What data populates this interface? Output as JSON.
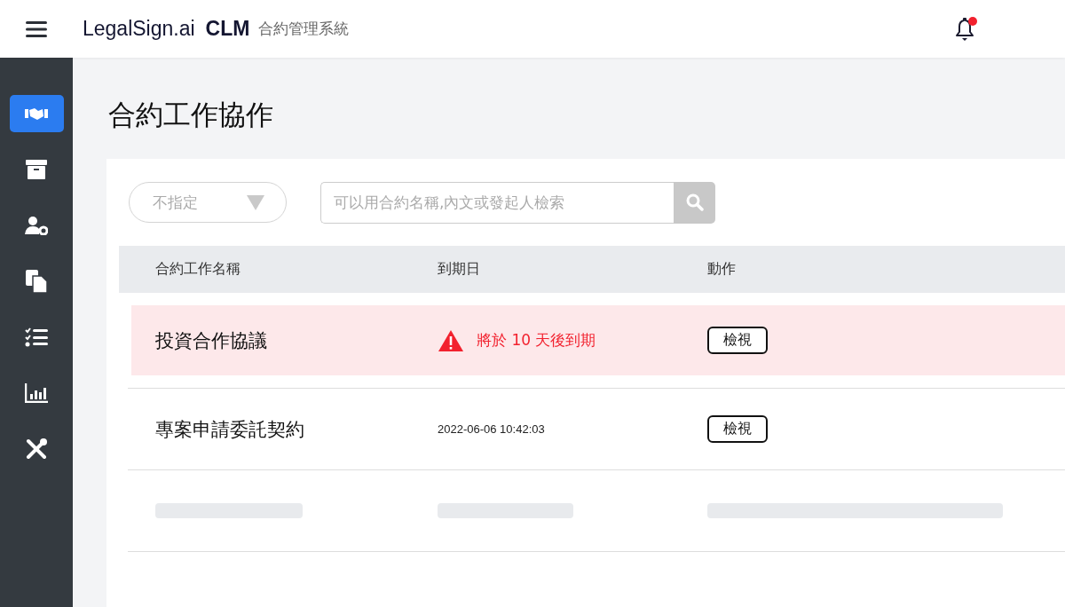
{
  "header": {
    "brand": "LegalSign.ai",
    "product": "CLM",
    "subtitle": "合約管理系統",
    "notification_dot": true
  },
  "sidebar": {
    "items": [
      {
        "selected": true
      },
      {
        "selected": false
      },
      {
        "selected": false
      },
      {
        "selected": false
      },
      {
        "selected": false
      },
      {
        "selected": false
      },
      {
        "selected": false
      }
    ]
  },
  "page": {
    "title": "合約工作協作"
  },
  "filter": {
    "value": "不指定"
  },
  "search": {
    "placeholder": "可以用合約名稱,內文或發起人檢索"
  },
  "table": {
    "columns": [
      "合約工作名稱",
      "到期日",
      "動作"
    ],
    "rows": [
      {
        "kind": "warning",
        "name": "投資合作協議",
        "due": "將於 10 天後到期",
        "action": "檢視"
      },
      {
        "kind": "normal",
        "name": "專案申請委託契約",
        "due": "2022-06-06 10:42:03",
        "action": "檢視"
      },
      {
        "kind": "skeleton"
      }
    ]
  }
}
